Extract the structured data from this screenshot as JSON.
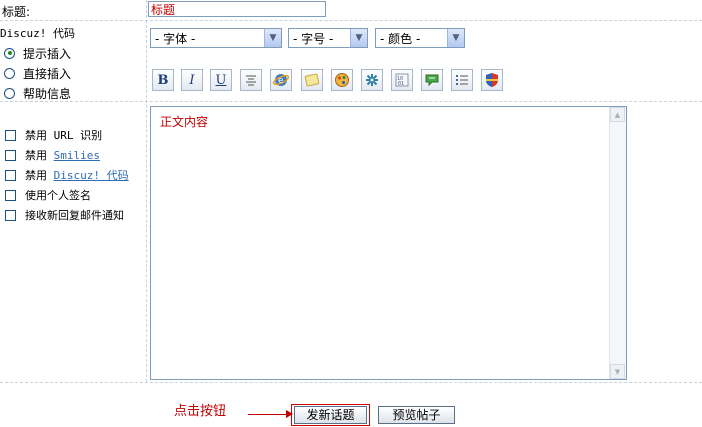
{
  "form": {
    "title_label": "标题:",
    "title_value": "标题"
  },
  "discuz": {
    "label": "Discuz! 代码",
    "modes": [
      {
        "label": "提示插入",
        "selected": true
      },
      {
        "label": "直接插入",
        "selected": false
      },
      {
        "label": "帮助信息",
        "selected": false
      }
    ]
  },
  "selects": {
    "font": "- 字体 -",
    "size": "- 字号 -",
    "color": "- 颜色 -"
  },
  "toolbar": {
    "bold": "B",
    "italic": "I",
    "underline": "U",
    "icons": [
      "bold-icon",
      "italic-icon",
      "underline-icon",
      "align-center-icon",
      "link-icon",
      "email-icon",
      "image-icon",
      "flash-icon",
      "code-icon",
      "quote-icon",
      "list-icon",
      "security-icon"
    ]
  },
  "options": {
    "disable_url": {
      "prefix": "禁用 ",
      "text": "URL 识别"
    },
    "disable_smilies": {
      "prefix": "禁用 ",
      "link": "Smilies"
    },
    "disable_discuz": {
      "prefix": "禁用 ",
      "link": "Discuz! 代码"
    },
    "use_signature": {
      "text": "使用个人签名"
    },
    "email_notify": {
      "text": "接收新回复邮件通知"
    }
  },
  "editor": {
    "content": "正文内容"
  },
  "annotation": {
    "hint": "点击按钮"
  },
  "buttons": {
    "submit": "发新话题",
    "preview": "预览帖子"
  },
  "colors": {
    "accent_red": "#c00000",
    "link_blue": "#2e6cb4",
    "border_blue": "#7f9db9"
  }
}
